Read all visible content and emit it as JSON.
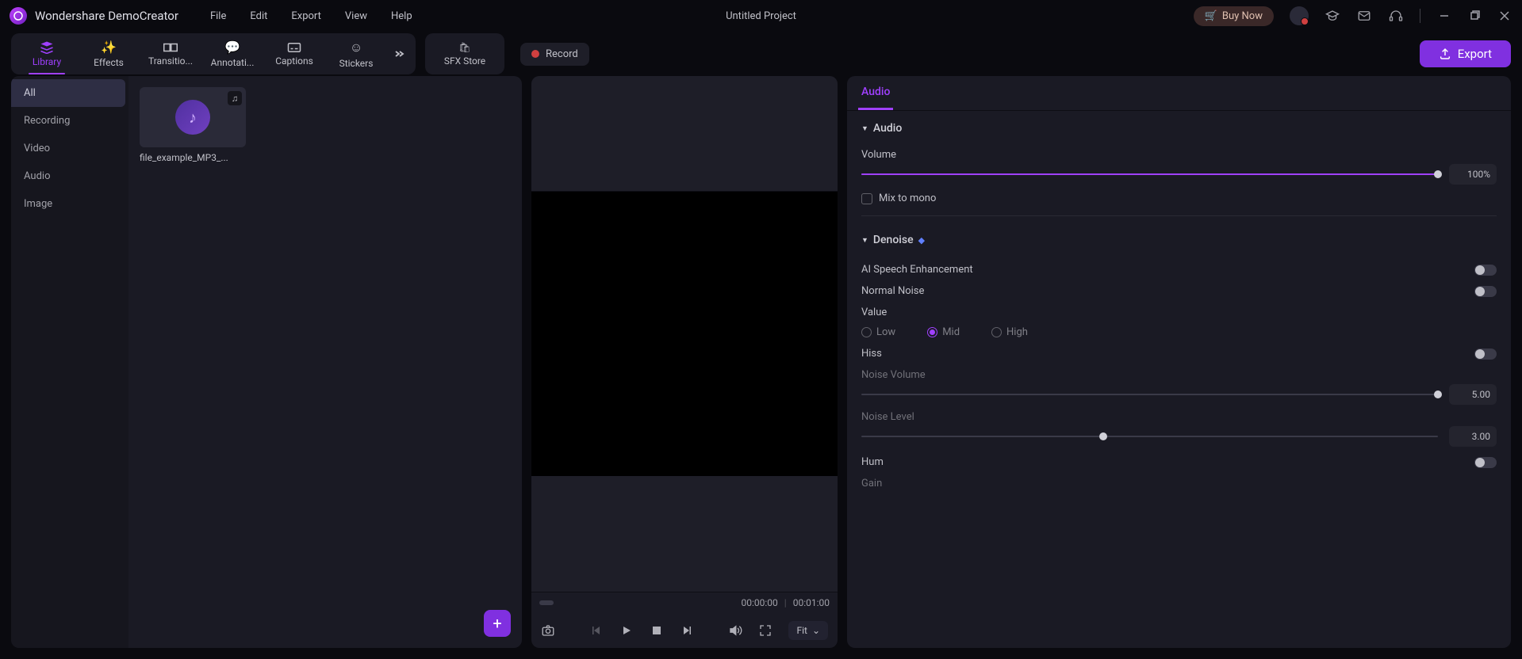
{
  "app_title": "Wondershare DemoCreator",
  "menus": [
    "File",
    "Edit",
    "Export",
    "View",
    "Help"
  ],
  "project_title": "Untitled Project",
  "buy_now": "Buy Now",
  "record_label": "Record",
  "export_label": "Export",
  "tabs": [
    {
      "label": "Library"
    },
    {
      "label": "Effects"
    },
    {
      "label": "Transitio..."
    },
    {
      "label": "Annotati..."
    },
    {
      "label": "Captions"
    },
    {
      "label": "Stickers"
    }
  ],
  "sfx_label": "SFX Store",
  "sidebar": [
    "All",
    "Recording",
    "Video",
    "Audio",
    "Image"
  ],
  "media": {
    "name": "file_example_MP3_..."
  },
  "time_current": "00:00:00",
  "time_total": "00:01:00",
  "fit_label": "Fit",
  "props_tab": "Audio",
  "audio_section": "Audio",
  "volume_label": "Volume",
  "volume_value": "100%",
  "mix_mono": "Mix to mono",
  "denoise_section": "Denoise",
  "ai_speech": "AI Speech Enhancement",
  "normal_noise": "Normal Noise",
  "value_label": "Value",
  "radios": {
    "low": "Low",
    "mid": "Mid",
    "high": "High"
  },
  "hiss": "Hiss",
  "noise_volume": "Noise Volume",
  "noise_volume_val": "5.00",
  "noise_level": "Noise Level",
  "noise_level_val": "3.00",
  "hum": "Hum",
  "gain": "Gain"
}
